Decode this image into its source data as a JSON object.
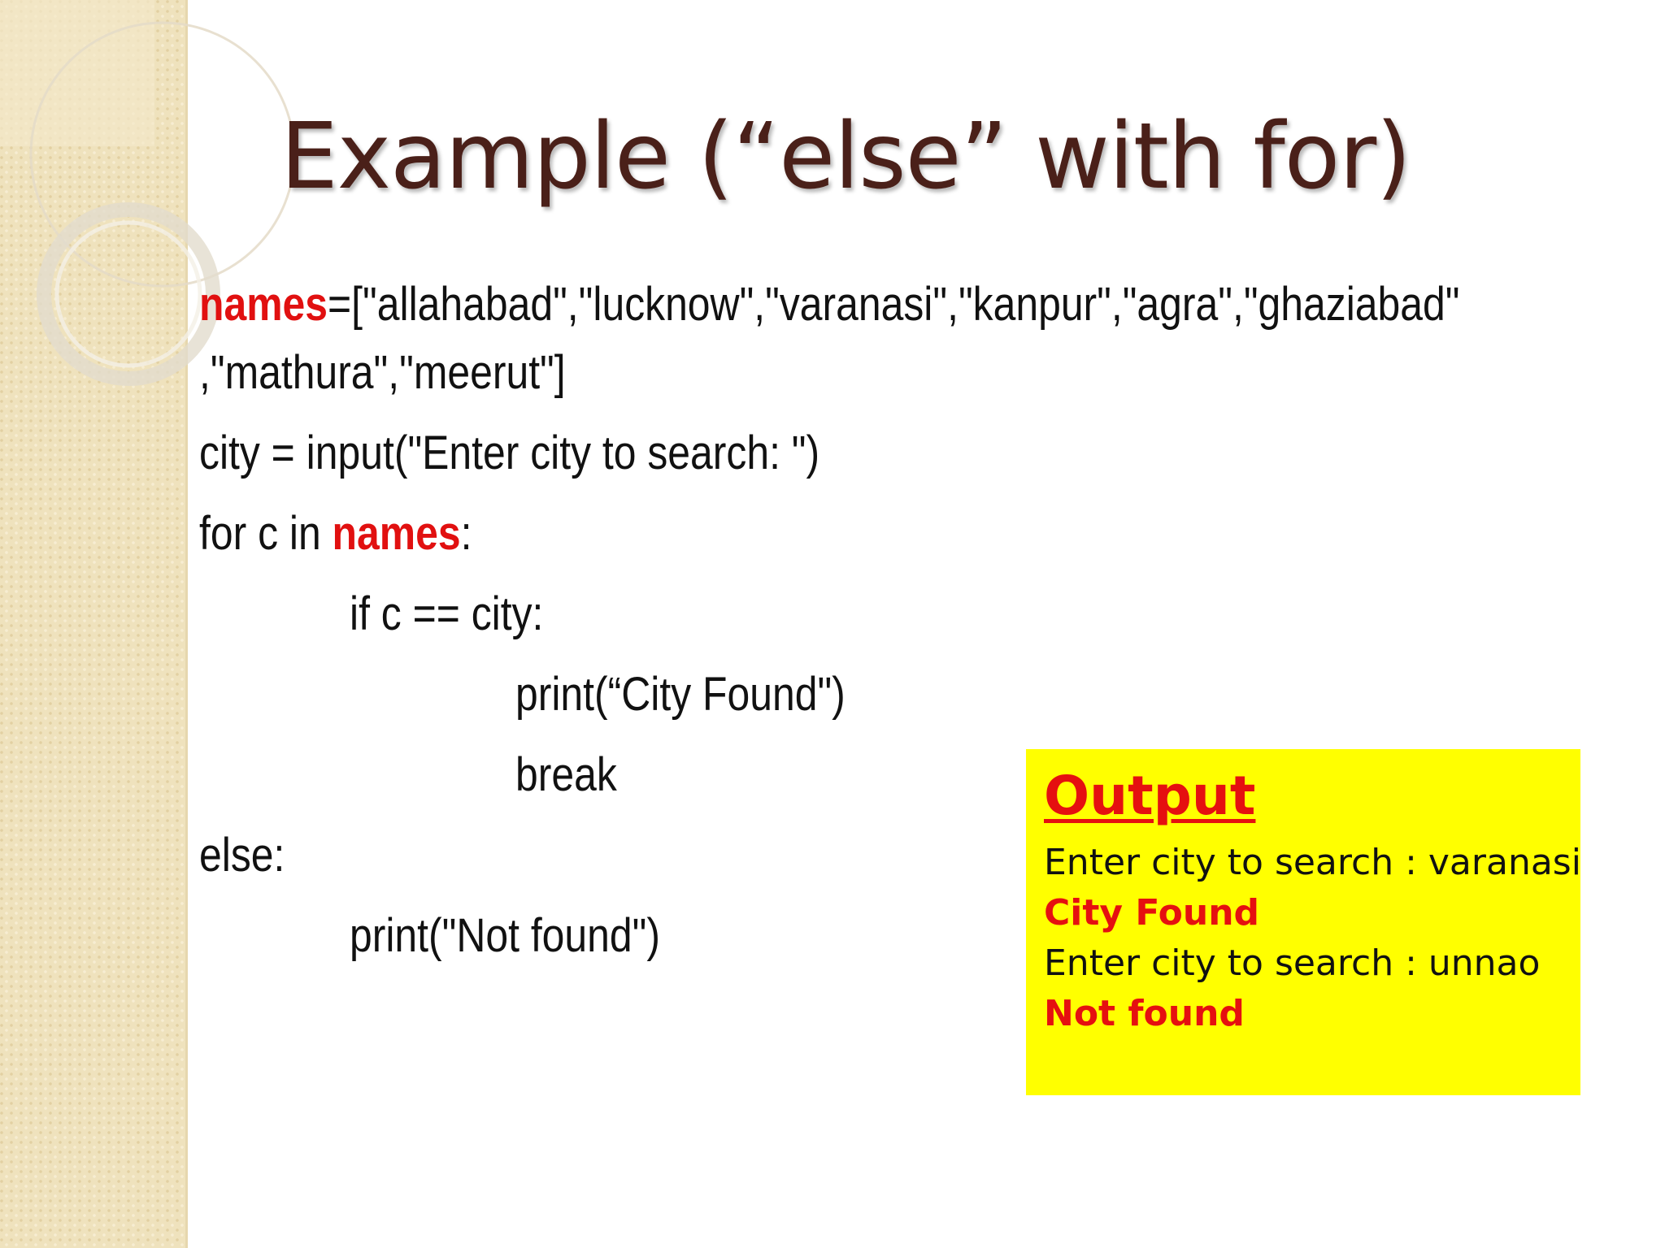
{
  "slide": {
    "title": "Example (“else” with for)",
    "code": {
      "line1_var": "names",
      "line1_rest": "=[\"allahabad\",\"lucknow\",\"varanasi\",\"kanpur\",\"agra\",\"ghaziabad\"",
      "line2": ",\"mathura\",\"meerut\"]",
      "line3": "city = input(\"Enter city to search: \")",
      "line4_pre": "for c in ",
      "line4_var": "names",
      "line4_post": ":",
      "line5": "if c == city:",
      "line6": "print(“City Found\")",
      "line7": "break",
      "line8": "else:",
      "line9": "print(\"Not found\")"
    },
    "output": {
      "title": "Output",
      "lines": [
        "Enter city to search : varanasi",
        "City Found",
        "Enter city to search : unnao",
        "Not found"
      ]
    }
  },
  "colors": {
    "title": "#4a2019",
    "highlight_red": "#e11010",
    "output_background": "#ffff00",
    "side_band": "#efe2bd"
  }
}
